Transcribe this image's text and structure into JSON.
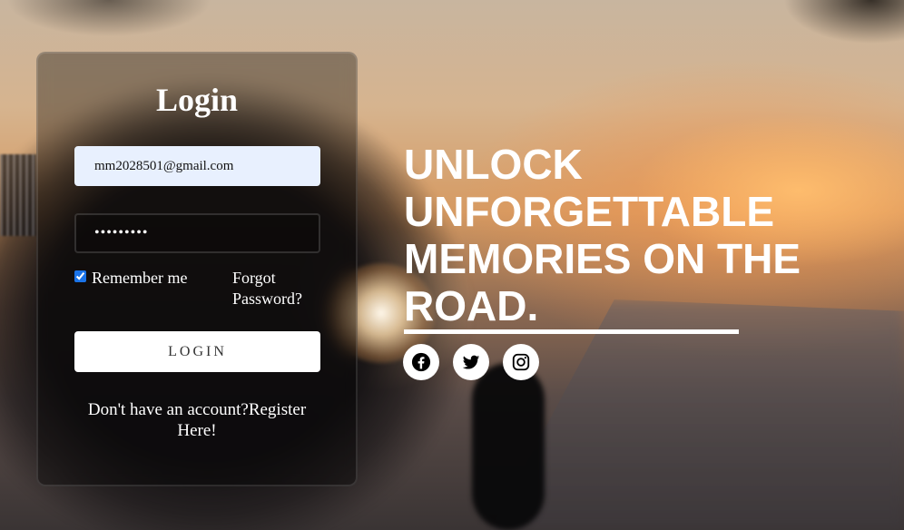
{
  "login": {
    "title": "Login",
    "email_value": "mm2028501@gmail.com",
    "password_value": "•••••••••",
    "remember_label": "Remember me",
    "remember_checked": true,
    "forgot_label": "Forgot Password?",
    "button_label": "LOGIN",
    "register_text": "Don't have an account?Register Here!"
  },
  "hero": {
    "headline": "UNLOCK UNFORGETTABLE MEMORIES ON THE ROAD."
  },
  "social": {
    "icons": [
      "facebook-icon",
      "twitter-icon",
      "instagram-icon"
    ]
  },
  "colors": {
    "text": "#ffffff",
    "autofill_bg": "#e8f0fe",
    "button_bg": "#ffffff",
    "checkbox": "#1a73e8"
  }
}
